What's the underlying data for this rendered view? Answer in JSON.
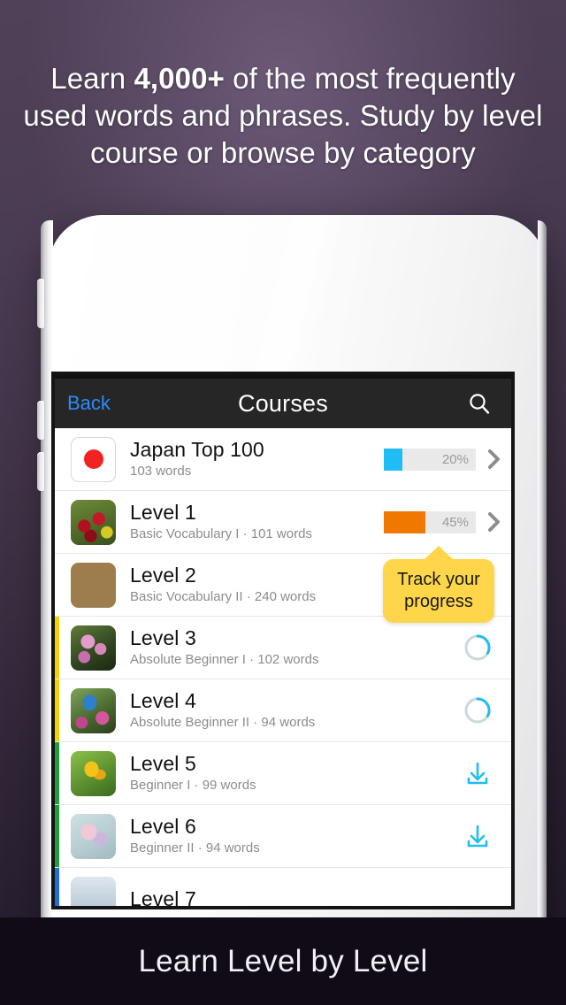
{
  "headline": {
    "line1_pre": "Learn ",
    "line1_bold": "4,000+",
    "line1_post": " of the most frequently",
    "line2": "used words and phrases. Study by level",
    "line3": "course or browse by category"
  },
  "footer": {
    "caption": "Learn Level by Level"
  },
  "app": {
    "navbar": {
      "back_label": "Back",
      "title": "Courses",
      "search_icon": "search-icon"
    },
    "tooltip": {
      "line1": "Track your",
      "line2": "progress"
    },
    "courses": [
      {
        "title": "Japan Top 100",
        "subtitle": "103 words",
        "thumb": "japan-flag",
        "strip_color": "none",
        "accessory": "progress",
        "progress_percent": 20,
        "progress_label": "20%",
        "progress_color": "#1ebdf5"
      },
      {
        "title": "Level 1",
        "subtitle": "Basic Vocabulary I · 101 words",
        "thumb": "tulips",
        "strip_color": "none",
        "accessory": "progress",
        "progress_percent": 45,
        "progress_label": "45%",
        "progress_color": "#f07800"
      },
      {
        "title": "Level 2",
        "subtitle": "Basic Vocabulary II · 240 words",
        "thumb": "books",
        "strip_color": "none",
        "accessory": "download",
        "progress_percent": null,
        "progress_label": "",
        "progress_color": ""
      },
      {
        "title": "Level 3",
        "subtitle": "Absolute Beginner I · 102 words",
        "thumb": "pink-flowers",
        "strip_color": "#f2d200",
        "accessory": "ring",
        "progress_percent": null,
        "progress_label": "",
        "progress_color": ""
      },
      {
        "title": "Level 4",
        "subtitle": "Absolute Beginner II · 94 words",
        "thumb": "bluebird",
        "strip_color": "#f2d200",
        "accessory": "ring",
        "progress_percent": null,
        "progress_label": "",
        "progress_color": ""
      },
      {
        "title": "Level 5",
        "subtitle": "Beginner I · 99 words",
        "thumb": "crocus",
        "strip_color": "#1f9e3a",
        "accessory": "download",
        "progress_percent": null,
        "progress_label": "",
        "progress_color": ""
      },
      {
        "title": "Level 6",
        "subtitle": "Beginner II · 94 words",
        "thumb": "pastel-flowers",
        "strip_color": "#1f9e3a",
        "accessory": "download",
        "progress_percent": null,
        "progress_label": "",
        "progress_color": ""
      },
      {
        "title": "Level 7",
        "subtitle": "",
        "thumb": "misty",
        "strip_color": "#1f6fd8",
        "accessory": "none",
        "progress_percent": null,
        "progress_label": "",
        "progress_color": ""
      }
    ]
  },
  "colors": {
    "nav_back_blue": "#2b8cfa",
    "accent_cyan": "#1ebdf5",
    "accent_orange": "#f07800",
    "tooltip_yellow": "#ffd54a",
    "flag_red": "#f02222"
  }
}
